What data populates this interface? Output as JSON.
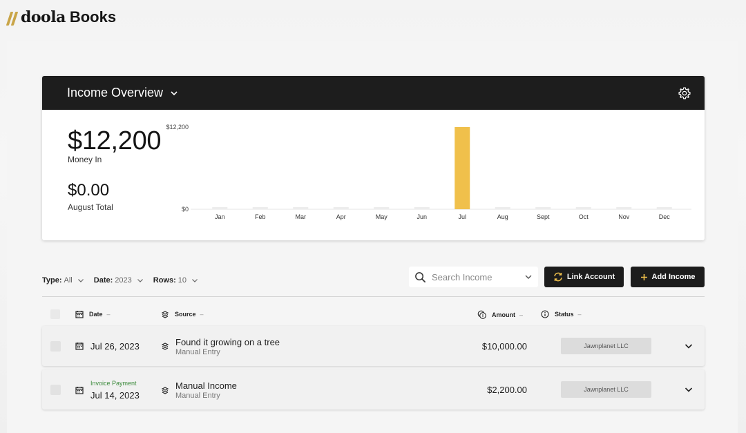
{
  "brand": {
    "name": "doola",
    "product": "Books",
    "accent": "#c9a548"
  },
  "overview": {
    "title": "Income Overview",
    "money_in_value": "$12,200",
    "money_in_label": "Money In",
    "month_total_value": "$0.00",
    "month_total_label": "August Total"
  },
  "chart_data": {
    "type": "bar",
    "categories": [
      "Jan",
      "Feb",
      "Mar",
      "Apr",
      "May",
      "Jun",
      "Jul",
      "Aug",
      "Sept",
      "Oct",
      "Nov",
      "Dec"
    ],
    "values": [
      0,
      0,
      0,
      0,
      0,
      0,
      12200,
      0,
      0,
      0,
      0,
      0
    ],
    "ytick_labels": [
      "$12,200",
      "$0"
    ],
    "ylim": [
      0,
      12200
    ],
    "bar_color": "#f0c04b",
    "empty_bar_color": "#ececec",
    "grid": false
  },
  "filters": {
    "type_label": "Type:",
    "type_value": "All",
    "date_label": "Date:",
    "date_value": "2023",
    "rows_label": "Rows:",
    "rows_value": "10"
  },
  "search": {
    "placeholder": "Search Income"
  },
  "buttons": {
    "link_account": "Link Account",
    "add_income": "Add Income"
  },
  "table": {
    "headers": {
      "date": "Date",
      "source": "Source",
      "amount": "Amount",
      "status": "Status"
    },
    "rows": [
      {
        "tag": "",
        "date": "Jul 26, 2023",
        "source": "Found it growing on a tree",
        "source_sub": "Manual Entry",
        "amount": "$10,000.00",
        "status": "Jawnplanet LLC"
      },
      {
        "tag": "Invoice Payment",
        "date": "Jul 14, 2023",
        "source": "Manual Income",
        "source_sub": "Manual Entry",
        "amount": "$2,200.00",
        "status": "Jawnplanet LLC"
      }
    ]
  }
}
